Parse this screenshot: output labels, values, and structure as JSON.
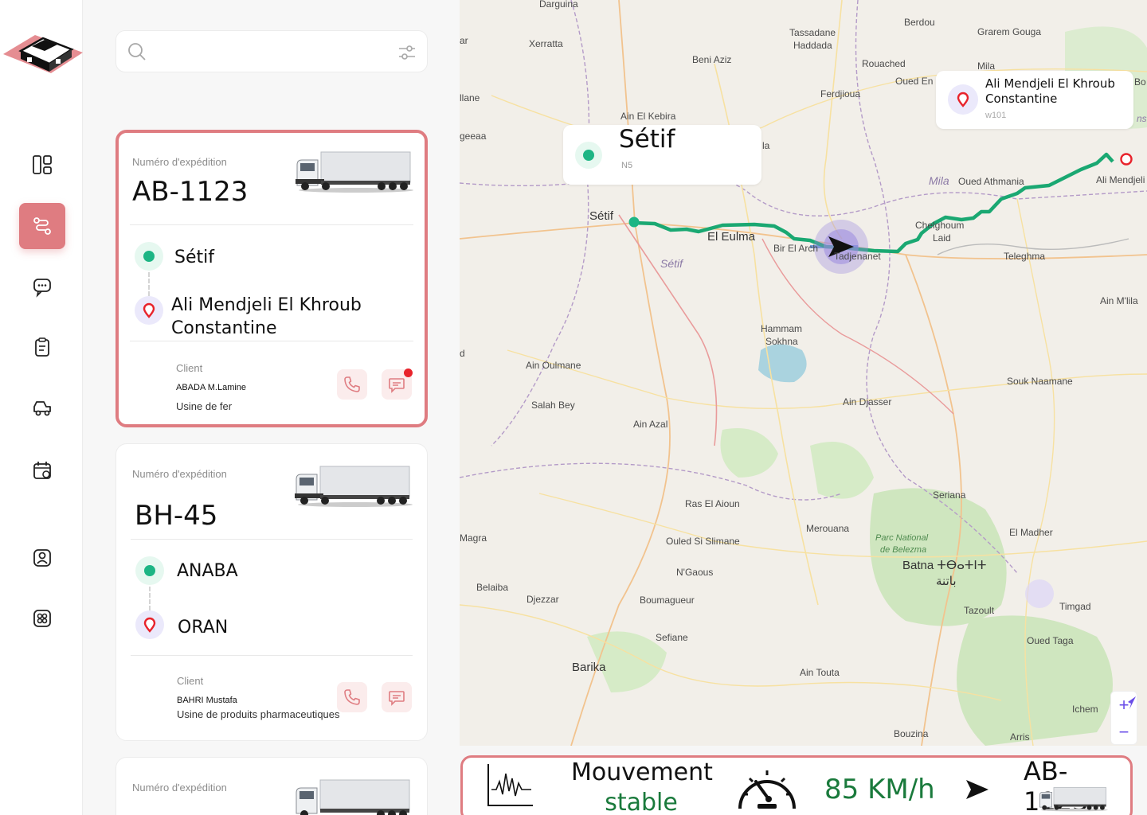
{
  "search": {
    "placeholder": ""
  },
  "cards": [
    {
      "number_label": "Numéro d'expédition",
      "id": "AB-1123",
      "origin": "Sétif",
      "destination_line1": "Ali Mendjeli  El Khroub",
      "destination_line2": "Constantine",
      "client_label": "Client",
      "client_name": "ABADA M.Lamine",
      "client_company": "Usine de fer"
    },
    {
      "number_label": "Numéro d'expédition",
      "id": "BH-45",
      "origin": "ANABA",
      "destination_line1": "ORAN",
      "client_label": "Client",
      "client_name": "BAHRI Mustafa",
      "client_company": "Usine de produits pharmaceutiques"
    },
    {
      "number_label": "Numéro d'expédition"
    }
  ],
  "map": {
    "origin_popup": {
      "title": "Sétif",
      "sub": "N5"
    },
    "dest_popup": {
      "line1": "Ali Mendjeli  El Khroub",
      "line2": "Constantine",
      "sub": "w101"
    },
    "zoom_in": "+",
    "zoom_out": "−",
    "labels": {
      "darguina": "Darguina",
      "berdou": "Berdou",
      "tassadane": "Tassadane",
      "haddada": "Haddada",
      "xerratta": "Xerratta",
      "beni_aziz": "Beni Aziz",
      "rouached": "Rouached",
      "grarem": "Grarem Gouga",
      "mila_top": "Mila",
      "oued_en": "Oued En",
      "ferdjioua": "Ferdjioua",
      "ain_kebira": "Ain El Kebira",
      "la": "la",
      "mila_it": "Mila",
      "oued_athmania": "Oued Athmania",
      "ali_mendjeli": "Ali Mendjeli",
      "setif_map": "Sétif",
      "setif_it": "Sétif",
      "el_eulma": "El Eulma",
      "bir_el_arch": "Bir El Arch",
      "tadjenanet": "Tadjenanet",
      "chelghoum": "Chelghoum",
      "laid": "Laid",
      "teleghma": "Teleghma",
      "ain_mlila": "Ain M'lila",
      "hammam": "Hammam",
      "sokhna": "Sokhna",
      "ain_oulmane": "Ain Oulmane",
      "salah_bey": "Salah Bey",
      "ain_djasser": "Ain Djasser",
      "souk_naamane": "Souk Naamane",
      "ain_azal": "Ain Azal",
      "seriana": "Seriana",
      "ras_el_aioun": "Ras El Aioun",
      "merouana": "Merouana",
      "parc1": "Parc National",
      "parc2": "de Belezma",
      "el_madher": "El Madher",
      "ouled_si": "Ouled Si Slimane",
      "batna": "Batna ⵜⴱⴰⵜⵏⵜ",
      "batna_ar": "باتنة",
      "ngaous": "N'Gaous",
      "belaiba": "Belaiba",
      "djezzar": "Djezzar",
      "boumagueur": "Boumagueur",
      "tazoult": "Tazoult",
      "timgad": "Timgad",
      "magra": "Magra",
      "sefiane": "Sefiane",
      "oued_taga": "Oued Taga",
      "barika": "Barika",
      "ain_touta": "Ain Touta",
      "ichem": "Ichem",
      "bouzina": "Bouzina",
      "arris": "Arris",
      "ar": "ar",
      "lane": "llane",
      "geeaa": "geeaa",
      "bo": "Bo",
      "ns": "ns",
      "d": "d"
    }
  },
  "status": {
    "movement_line1": "Mouvement",
    "movement_line2": "stable",
    "speed": "85 KM/h",
    "shipment_id": "AB-1123"
  }
}
